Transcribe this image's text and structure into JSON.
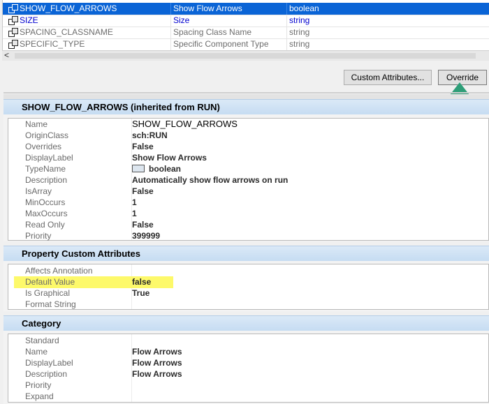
{
  "property_list": {
    "rows": [
      {
        "name": "SHOW_FLOW_ARROWS",
        "display": "Show Flow Arrows",
        "type": "boolean",
        "state": "selected"
      },
      {
        "name": "SIZE",
        "display": "Size",
        "type": "string",
        "state": "blue"
      },
      {
        "name": "SPACING_CLASSNAME",
        "display": "Spacing Class Name",
        "type": "string",
        "state": "gray"
      },
      {
        "name": "SPECIFIC_TYPE",
        "display": "Specific Component Type",
        "type": "string",
        "state": "gray"
      }
    ],
    "scroll_left_glyph": "<"
  },
  "buttons": {
    "custom_attributes": "Custom Attributes...",
    "override": "Override"
  },
  "details": {
    "title": "SHOW_FLOW_ARROWS (inherited from RUN)",
    "rows": [
      {
        "key": "Name",
        "value": "SHOW_FLOW_ARROWS"
      },
      {
        "key": "OriginClass",
        "value": "sch:RUN"
      },
      {
        "key": "Overrides",
        "value": "False"
      },
      {
        "key": "DisplayLabel",
        "value": "Show Flow Arrows"
      },
      {
        "key": "TypeName",
        "value": "boolean"
      },
      {
        "key": "Description",
        "value": "Automatically show flow arrows on run"
      },
      {
        "key": "IsArray",
        "value": "False"
      },
      {
        "key": "MinOccurs",
        "value": "1"
      },
      {
        "key": "MaxOccurs",
        "value": "1"
      },
      {
        "key": "Read Only",
        "value": "False"
      },
      {
        "key": "Priority",
        "value": "399999"
      }
    ]
  },
  "custom_attributes": {
    "title": "Property Custom Attributes",
    "rows": [
      {
        "key": "Affects Annotation",
        "value": ""
      },
      {
        "key": "Default Value",
        "value": "false"
      },
      {
        "key": "Is Graphical",
        "value": "True"
      },
      {
        "key": "Format String",
        "value": ""
      }
    ]
  },
  "category": {
    "title": "Category",
    "rows": [
      {
        "key": "Standard",
        "value": ""
      },
      {
        "key": "Name",
        "value": "Flow Arrows"
      },
      {
        "key": "DisplayLabel",
        "value": "Flow Arrows"
      },
      {
        "key": "Description",
        "value": "Flow Arrows"
      },
      {
        "key": "Priority",
        "value": ""
      },
      {
        "key": "Expand",
        "value": ""
      }
    ]
  },
  "colors": {
    "selection": "#0a64d6",
    "section_header": "#c6dcf2",
    "highlight": "#fdf96a",
    "callout_arrow": "#2e9e78"
  },
  "icons": {
    "row_icon": "property-icon",
    "type_icon": "boolean-type-icon",
    "callout": "arrow-up-icon"
  }
}
